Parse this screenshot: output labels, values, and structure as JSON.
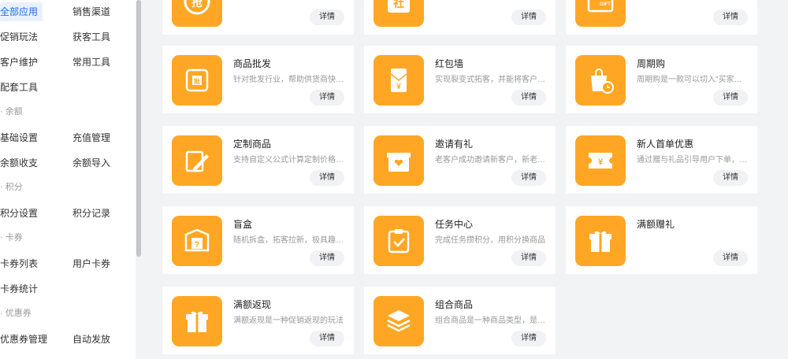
{
  "sidebar": {
    "rows": [
      {
        "left": "全部应用",
        "right": "销售渠道",
        "left_active": true
      },
      {
        "left": "促销玩法",
        "right": "获客工具"
      },
      {
        "left": "客户维护",
        "right": "常用工具"
      },
      {
        "left": "配套工具",
        "right": ""
      }
    ],
    "groups": [
      {
        "label": "· 余额",
        "rows": [
          {
            "left": "基础设置",
            "right": "充值管理"
          },
          {
            "left": "余额收支",
            "right": "余额导入"
          }
        ]
      },
      {
        "label": "· 积分",
        "rows": [
          {
            "left": "积分设置",
            "right": "积分记录"
          }
        ]
      },
      {
        "label": "· 卡券",
        "rows": [
          {
            "left": "卡券列表",
            "right": "用户卡券"
          },
          {
            "left": "卡券统计",
            "right": ""
          }
        ]
      },
      {
        "label": "· 优惠券",
        "rows": [
          {
            "left": "优惠券管理",
            "right": "自动发放"
          }
        ]
      }
    ]
  },
  "detail_label": "详情",
  "top_cards": [
    {
      "icon": "grab-icon",
      "icon_text": "抢"
    },
    {
      "icon": "community-icon",
      "icon_text": "社"
    },
    {
      "icon": "gift-card-icon",
      "icon_text": "GIFT"
    }
  ],
  "cards": [
    {
      "title": "商品批发",
      "desc": "针对批发行业，帮助供货商快速批量销售商品",
      "icon": "wholesale-icon",
      "icon_text": "批"
    },
    {
      "title": "红包墙",
      "desc": "实现裂变式拓客，并能将客户沉淀",
      "icon": "red-envelope-icon",
      "icon_text": "¥"
    },
    {
      "title": "周期购",
      "desc": "周期购是一款可以切入\"买家一次下单多次配送\"",
      "icon": "periodic-purchase-icon",
      "icon_text": ""
    },
    {
      "title": "定制商品",
      "desc": "支持自定义公式计算定制价格的商品",
      "icon": "custom-goods-icon",
      "icon_text": ""
    },
    {
      "title": "邀请有礼",
      "desc": "老客户成功邀请新客户，新老客户均可获得奖励",
      "icon": "invite-gift-icon",
      "icon_text": ""
    },
    {
      "title": "新人首单优惠",
      "desc": "通过赠与礼品引导用户下单，提升新人转化",
      "icon": "new-user-coupon-icon",
      "icon_text": "¥"
    },
    {
      "title": "盲盒",
      "desc": "随机拆盒，拓客拉新，极具趣味性",
      "icon": "blind-box-icon",
      "icon_text": "?"
    },
    {
      "title": "任务中心",
      "desc": "完成任务攒积分，用积分换商品",
      "icon": "task-center-icon",
      "icon_text": ""
    },
    {
      "title": "满额赠礼",
      "desc": "",
      "icon": "full-gift-icon",
      "icon_text": ""
    },
    {
      "title": "满额返现",
      "desc": "满额返现是一种促销返现的玩法",
      "icon": "cashback-icon",
      "icon_text": ""
    },
    {
      "title": "组合商品",
      "desc": "组合商品是一种商品类型，是多个商品的组合",
      "icon": "bundle-goods-icon",
      "icon_text": ""
    }
  ]
}
